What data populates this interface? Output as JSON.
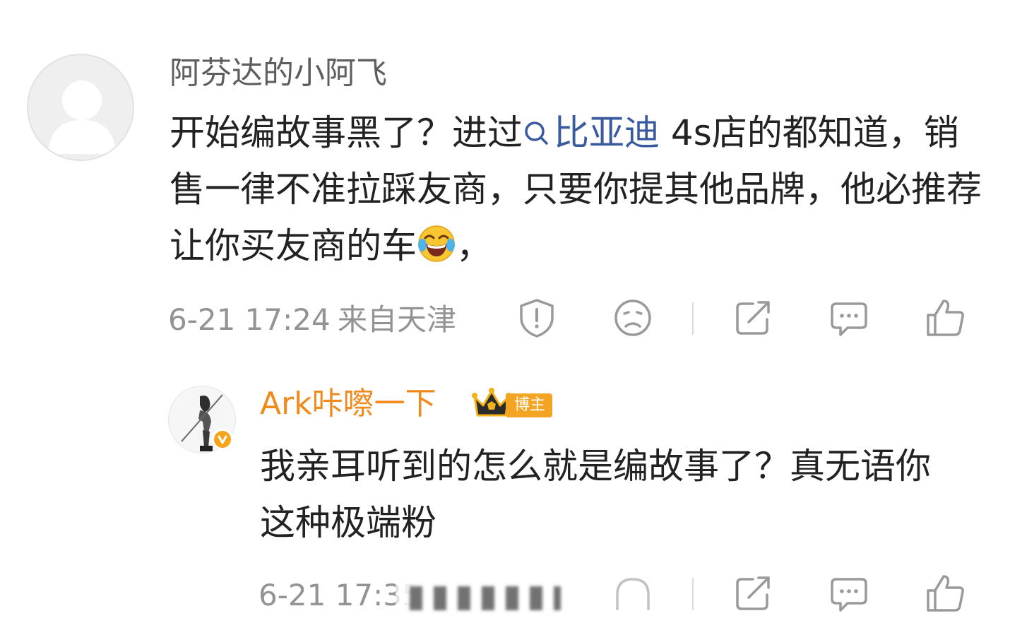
{
  "comments": [
    {
      "username": "阿芬达的小阿飞",
      "text_before_topic": "开始编故事黑了？进过",
      "topic": "比亚迪",
      "text_after_topic": " 4s店的都知道，销售一律不准拉踩友商，只要你提其他品牌，他必推荐让你买友商的车",
      "emoji": "laugh-cry-emoji",
      "text_after_emoji": "，",
      "time": "6-21 17:24",
      "location": "来自天津",
      "actions": [
        "report-icon",
        "dislike-icon",
        "share-icon",
        "comment-icon",
        "like-icon"
      ]
    },
    {
      "username": "Ark咔嚓一下",
      "badge": "博主",
      "verified": true,
      "text": "我亲耳听到的怎么就是编故事了？真无语你这种极端粉",
      "time": "6-21 17:35",
      "actions": [
        "share-icon",
        "comment-icon",
        "like-icon"
      ]
    }
  ],
  "colors": {
    "topic": "#3a5a9f",
    "blogger_name": "#f18a1d",
    "badge": "#f3a422",
    "meta": "#939393"
  }
}
